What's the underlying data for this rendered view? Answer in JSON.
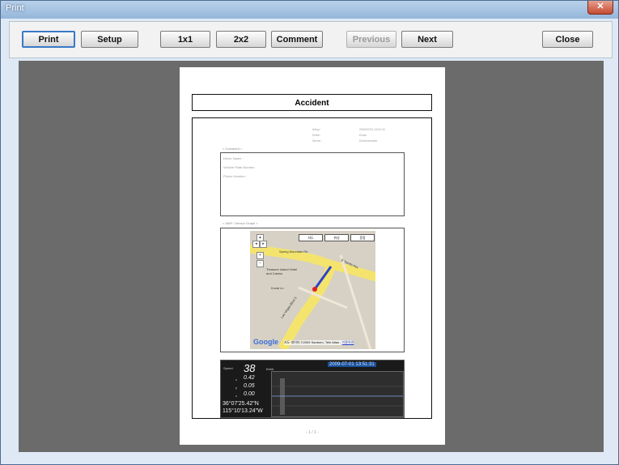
{
  "window": {
    "title": "Print",
    "close_glyph": "✕"
  },
  "toolbar": {
    "print": "Print",
    "setup": "Setup",
    "layout_1x1": "1x1",
    "layout_2x2": "2x2",
    "comment": "Comment",
    "previous": "Previous",
    "next": "Next",
    "close": "Close"
  },
  "page": {
    "title": "Accident",
    "info_lines": [
      {
        "label": "Setup :",
        "value": "2009/07/01 13:51:31"
      },
      {
        "label": "Driver :",
        "value": "Driver"
      },
      {
        "label": "Server :",
        "value": "Driverrecorder"
      }
    ],
    "comment_section": "< Comment >",
    "comment_lines": [
      "Driver Name :",
      "Vehicle Plate Number :",
      "Phone Number :"
    ],
    "map_section": "< MAP / Sensor Graph >",
    "page_number": "- 1 / 1 -"
  },
  "map": {
    "tabs": [
      "지도",
      "위성",
      "혼합"
    ],
    "road_label": "Spring Mountain Rd",
    "road_label_2": "E Sands Ave",
    "road_label_3": "Las Vegas Blvd S",
    "road_label_4": "Koval Ln",
    "landmark": "Treasure Island Hotel and Casino",
    "google": "Google",
    "attribution": "지도 데이터 ©2009 Sanborn, Tele Atlas -",
    "attribution_link": "이용약관"
  },
  "telemetry": {
    "speed_label": "Speed",
    "speed": "38",
    "speed_unit": "Km/h",
    "x": {
      "label": "x",
      "value": "0.42"
    },
    "y": {
      "label": "y",
      "value": "0.05"
    },
    "z": {
      "label": "z",
      "value": "0.00"
    },
    "latitude": "36°07'25.42\"N",
    "longitude": "115°10'13.24\"W",
    "datetime": "2009-07-01 13:51:31"
  },
  "colors": {
    "preview_bg": "#6b6b6b",
    "road": "#f4e46e",
    "route": "#2b44c8",
    "marker": "#e02020"
  }
}
